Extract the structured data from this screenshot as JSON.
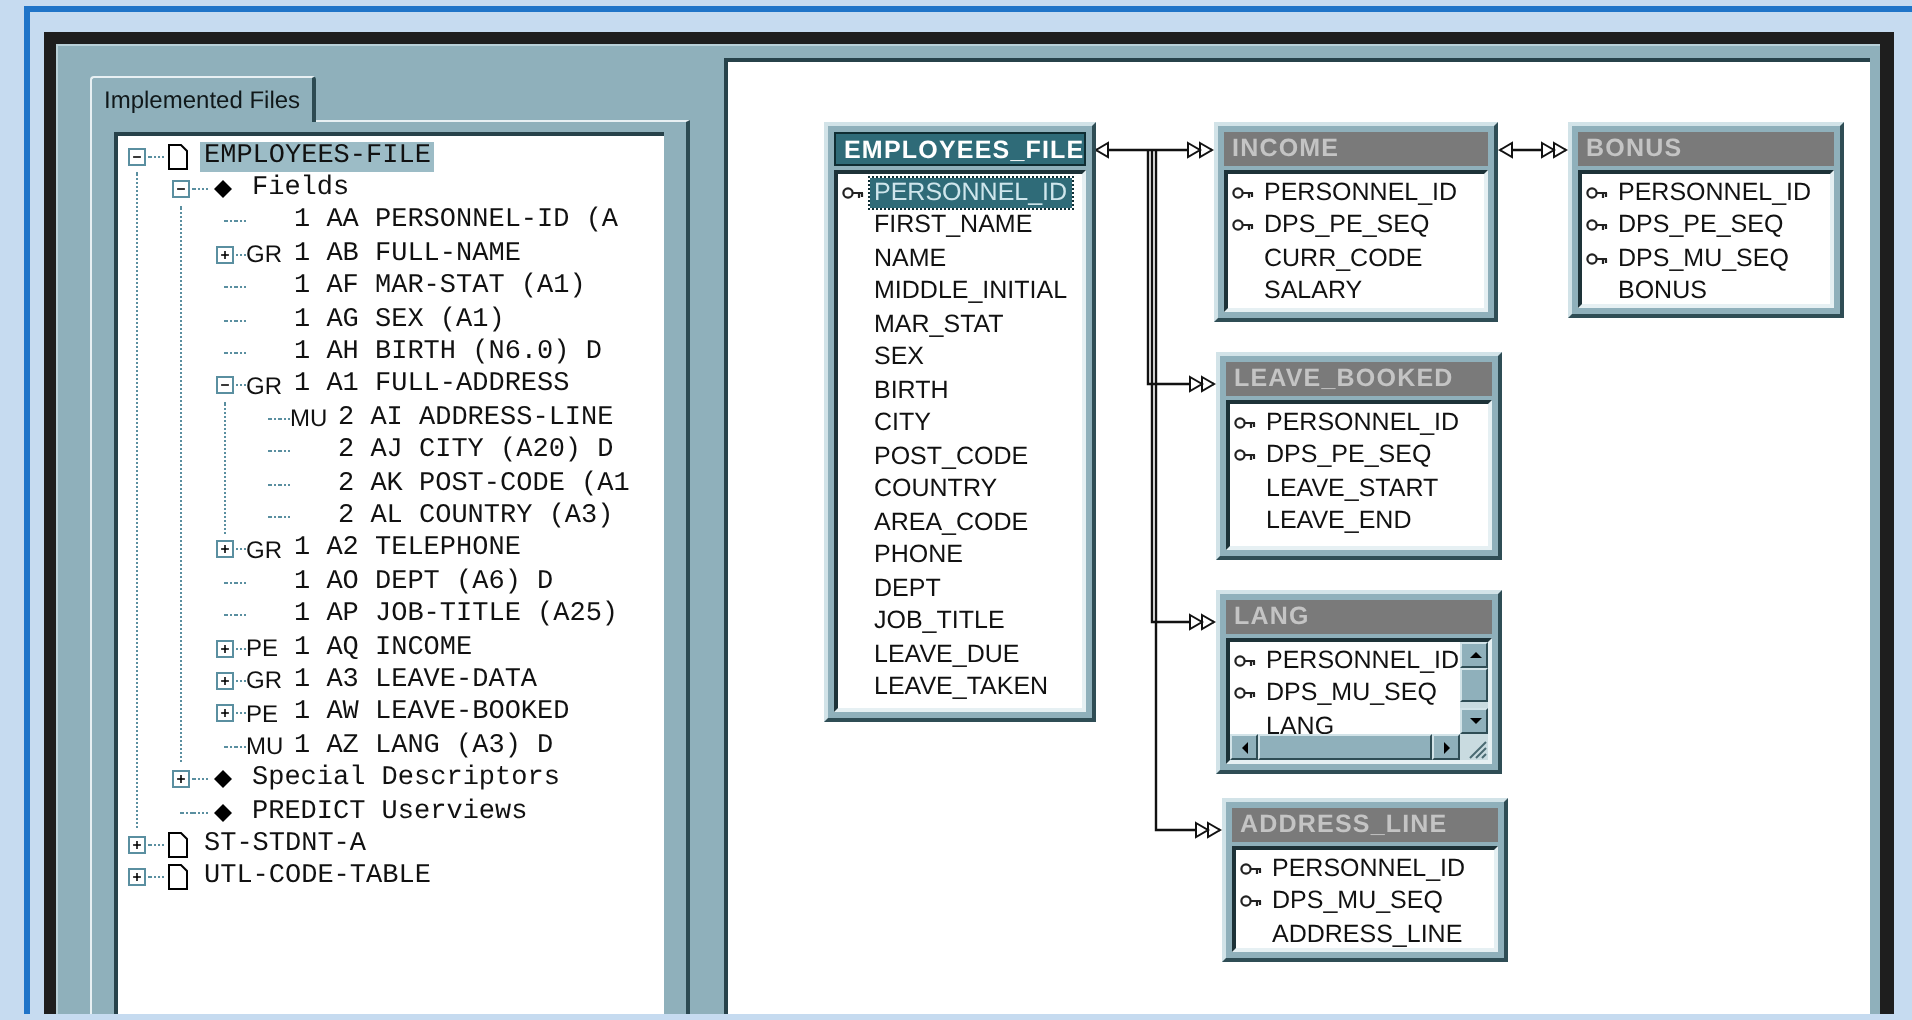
{
  "tabs": [
    {
      "label": "Implemented Files",
      "selected": true
    }
  ],
  "tree": [
    {
      "kind": "file",
      "label": "EMPLOYEES-FILE",
      "expanded": true,
      "selected": true,
      "children": [
        {
          "kind": "group",
          "label": "Fields",
          "expanded": true,
          "selected": false,
          "children": [
            {
              "kind": "field",
              "label": "1 AA PERSONNEL-ID (A",
              "selected": false
            },
            {
              "kind": "field",
              "prefix": "GR",
              "label": "1 AB FULL-NAME",
              "expanded": false,
              "selected": false
            },
            {
              "kind": "field",
              "label": "1 AF MAR-STAT (A1)",
              "selected": false
            },
            {
              "kind": "field",
              "label": "1 AG SEX (A1)",
              "selected": false
            },
            {
              "kind": "field",
              "label": "1 AH BIRTH (N6.0) D",
              "selected": false
            },
            {
              "kind": "field",
              "prefix": "GR",
              "label": "1 A1 FULL-ADDRESS",
              "expanded": true,
              "selected": false,
              "children": [
                {
                  "kind": "field",
                  "prefix": "MU",
                  "label": "2 AI ADDRESS-LINE",
                  "selected": false
                },
                {
                  "kind": "field",
                  "label": "2 AJ CITY (A20) D",
                  "selected": false
                },
                {
                  "kind": "field",
                  "label": "2 AK POST-CODE (A1",
                  "selected": false
                },
                {
                  "kind": "field",
                  "label": "2 AL COUNTRY (A3)",
                  "selected": false
                }
              ]
            },
            {
              "kind": "field",
              "prefix": "GR",
              "label": "1 A2 TELEPHONE",
              "expanded": false,
              "selected": false
            },
            {
              "kind": "field",
              "label": "1 AO DEPT (A6) D",
              "selected": false
            },
            {
              "kind": "field",
              "label": "1 AP JOB-TITLE (A25)",
              "selected": false
            },
            {
              "kind": "field",
              "prefix": "PE",
              "label": "1 AQ INCOME",
              "expanded": false,
              "selected": false
            },
            {
              "kind": "field",
              "prefix": "GR",
              "label": "1 A3 LEAVE-DATA",
              "expanded": false,
              "selected": false
            },
            {
              "kind": "field",
              "prefix": "PE",
              "label": "1 AW LEAVE-BOOKED",
              "expanded": false,
              "selected": false
            },
            {
              "kind": "field",
              "prefix": "MU",
              "label": "1 AZ LANG (A3) D",
              "selected": false
            }
          ]
        },
        {
          "kind": "group",
          "label": "Special Descriptors",
          "expanded": false,
          "selected": false
        },
        {
          "kind": "group",
          "label": "PREDICT Userviews",
          "selected": false
        }
      ]
    },
    {
      "kind": "file",
      "label": "ST-STDNT-A",
      "expanded": false,
      "selected": false
    },
    {
      "kind": "file",
      "label": "UTL-CODE-TABLE",
      "expanded": false,
      "selected": false
    }
  ],
  "tables": [
    {
      "title": "EMPLOYEES_FILE",
      "selected": true,
      "scrollbars": false,
      "columns": [
        {
          "name": "PERSONNEL_ID",
          "key": true,
          "selected": true
        },
        {
          "name": "FIRST_NAME",
          "key": false,
          "selected": false
        },
        {
          "name": "NAME",
          "key": false,
          "selected": false
        },
        {
          "name": "MIDDLE_INITIAL",
          "key": false,
          "selected": false
        },
        {
          "name": "MAR_STAT",
          "key": false,
          "selected": false
        },
        {
          "name": "SEX",
          "key": false,
          "selected": false
        },
        {
          "name": "BIRTH",
          "key": false,
          "selected": false
        },
        {
          "name": "CITY",
          "key": false,
          "selected": false
        },
        {
          "name": "POST_CODE",
          "key": false,
          "selected": false
        },
        {
          "name": "COUNTRY",
          "key": false,
          "selected": false
        },
        {
          "name": "AREA_CODE",
          "key": false,
          "selected": false
        },
        {
          "name": "PHONE",
          "key": false,
          "selected": false
        },
        {
          "name": "DEPT",
          "key": false,
          "selected": false
        },
        {
          "name": "JOB_TITLE",
          "key": false,
          "selected": false
        },
        {
          "name": "LEAVE_DUE",
          "key": false,
          "selected": false
        },
        {
          "name": "LEAVE_TAKEN",
          "key": false,
          "selected": false
        }
      ]
    },
    {
      "title": "INCOME",
      "selected": false,
      "scrollbars": false,
      "columns": [
        {
          "name": "PERSONNEL_ID",
          "key": true,
          "selected": false
        },
        {
          "name": "DPS_PE_SEQ",
          "key": true,
          "selected": false
        },
        {
          "name": "CURR_CODE",
          "key": false,
          "selected": false
        },
        {
          "name": "SALARY",
          "key": false,
          "selected": false
        }
      ]
    },
    {
      "title": "BONUS",
      "selected": false,
      "scrollbars": false,
      "columns": [
        {
          "name": "PERSONNEL_ID",
          "key": true,
          "selected": false
        },
        {
          "name": "DPS_PE_SEQ",
          "key": true,
          "selected": false
        },
        {
          "name": "DPS_MU_SEQ",
          "key": true,
          "selected": false
        },
        {
          "name": "BONUS",
          "key": false,
          "selected": false
        }
      ]
    },
    {
      "title": "LEAVE_BOOKED",
      "selected": false,
      "scrollbars": false,
      "columns": [
        {
          "name": "PERSONNEL_ID",
          "key": true,
          "selected": false
        },
        {
          "name": "DPS_PE_SEQ",
          "key": true,
          "selected": false
        },
        {
          "name": "LEAVE_START",
          "key": false,
          "selected": false
        },
        {
          "name": "LEAVE_END",
          "key": false,
          "selected": false
        }
      ]
    },
    {
      "title": "LANG",
      "selected": false,
      "scrollbars": true,
      "columns": [
        {
          "name": "PERSONNEL_ID",
          "key": true,
          "selected": false
        },
        {
          "name": "DPS_MU_SEQ",
          "key": true,
          "selected": false
        },
        {
          "name": "LANG",
          "key": false,
          "selected": false
        }
      ]
    },
    {
      "title": "ADDRESS_LINE",
      "selected": false,
      "scrollbars": false,
      "columns": [
        {
          "name": "PERSONNEL_ID",
          "key": true,
          "selected": false
        },
        {
          "name": "DPS_MU_SEQ",
          "key": true,
          "selected": false
        },
        {
          "name": "ADDRESS_LINE",
          "key": false,
          "selected": false
        }
      ]
    }
  ]
}
